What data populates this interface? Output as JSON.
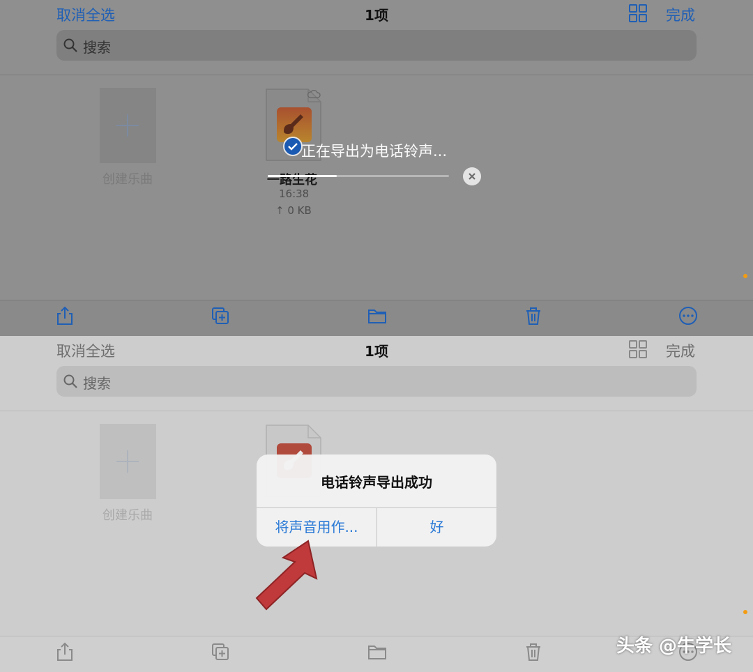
{
  "panel1": {
    "nav": {
      "left": "取消全选",
      "title": "1项",
      "right": "完成",
      "grid_icon": "grid-icon"
    },
    "search": {
      "placeholder": "搜索",
      "icon": "search-icon"
    },
    "create_tile": {
      "label": "创建乐曲",
      "icon": "plus-icon"
    },
    "file": {
      "name": "一路生花",
      "time": "16:38",
      "size": "↑ 0 KB",
      "icon": "garageband-icon",
      "cloud_icon": "cloud-icon"
    },
    "export": {
      "text": "正在导出为电话铃声...",
      "progress": 0.38,
      "close_icon": "close-icon"
    },
    "toolbar": [
      "share-icon",
      "duplicate-icon",
      "folder-icon",
      "trash-icon",
      "more-icon"
    ]
  },
  "panel2": {
    "nav": {
      "left": "取消全选",
      "title": "1项",
      "right": "完成",
      "grid_icon": "grid-icon"
    },
    "search": {
      "placeholder": "搜索",
      "icon": "search-icon"
    },
    "create_tile": {
      "label": "创建乐曲",
      "icon": "plus-icon"
    },
    "alert": {
      "title": "电话铃声导出成功",
      "use_as": "将声音用作...",
      "ok": "好"
    },
    "toolbar": [
      "share-icon",
      "duplicate-icon",
      "folder-icon",
      "trash-icon",
      "more-icon"
    ],
    "watermark": "头条 @牛学长"
  },
  "colors": {
    "accent": "#1f5fb5",
    "accent_alert": "#2778d6",
    "arrow": "#c0393b",
    "orange_dot": "#f39c12"
  }
}
